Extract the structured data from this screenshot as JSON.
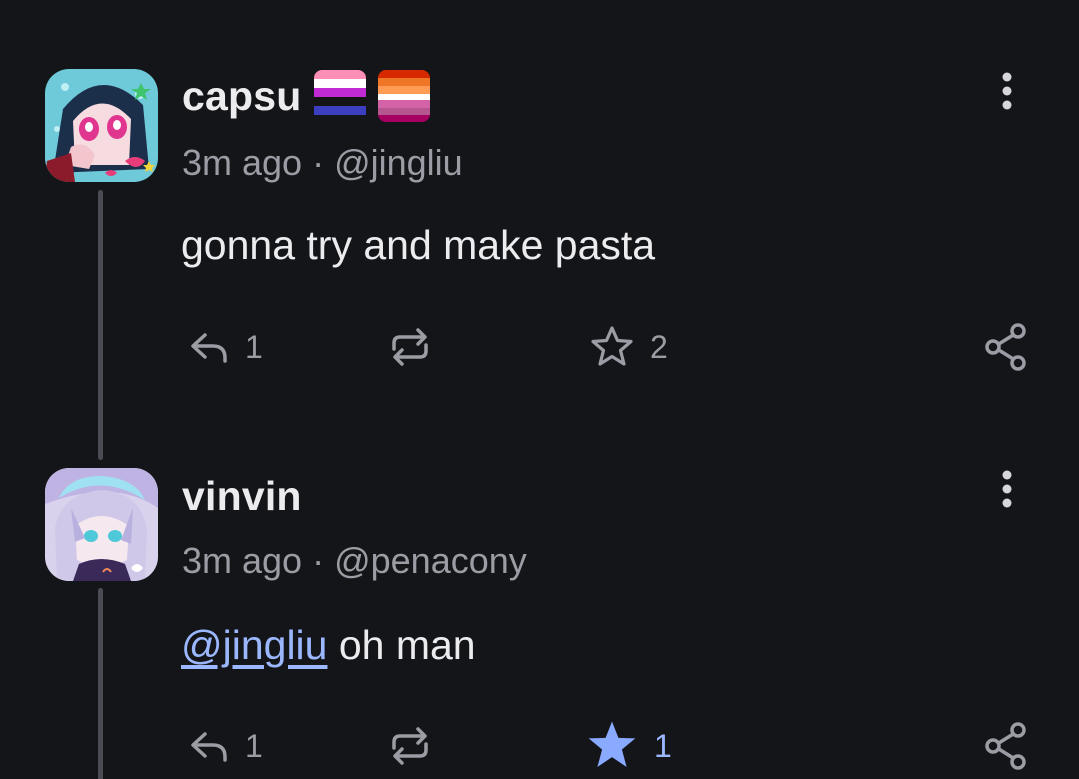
{
  "colors": {
    "background": "#141519",
    "text_primary": "#ececef",
    "text_secondary": "#9b9ca4",
    "accent_link": "#9bb8ff",
    "star_active": "#8aaaff",
    "thread_line": "#4a4c55"
  },
  "posts": [
    {
      "display_name": "capsu",
      "flags": [
        "genderfluid-flag",
        "lesbian-flag"
      ],
      "time": "3m ago",
      "separator": "·",
      "handle": "@jingliu",
      "body_mention": "",
      "body_text": "gonna try and make pasta",
      "reply_count": "1",
      "repost_count": "",
      "favorite_count": "2",
      "favorited": false,
      "icons": {
        "more": "more-vertical-icon",
        "reply": "reply-icon",
        "repost": "repost-icon",
        "favorite": "star-outline-icon",
        "share": "share-icon"
      }
    },
    {
      "display_name": "vinvin",
      "flags": [],
      "time": "3m ago",
      "separator": "·",
      "handle": "@penacony",
      "body_mention": "@jingliu",
      "body_text": " oh man",
      "reply_count": "1",
      "repost_count": "",
      "favorite_count": "1",
      "favorited": true,
      "icons": {
        "more": "more-vertical-icon",
        "reply": "reply-icon",
        "repost": "repost-icon",
        "favorite": "star-filled-icon",
        "share": "share-icon"
      }
    }
  ]
}
